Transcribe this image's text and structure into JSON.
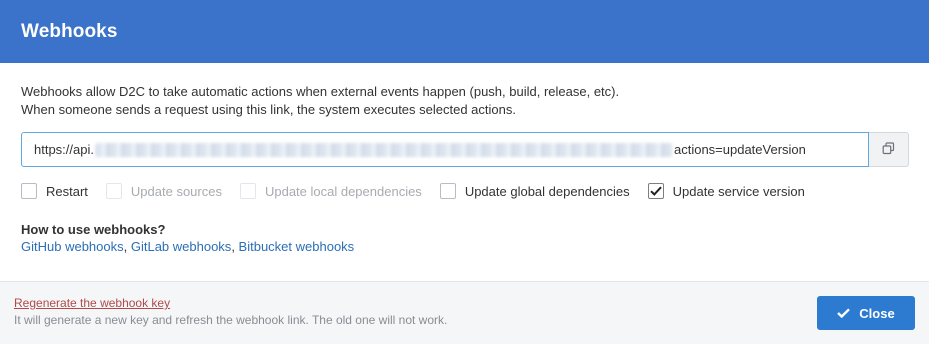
{
  "header": {
    "title": "Webhooks"
  },
  "description": {
    "line1": "Webhooks allow D2C to take automatic actions when external events happen (push, build, release, etc).",
    "line2": "When someone sends a request using this link, the system executes selected actions."
  },
  "url": {
    "prefix": "https://api.",
    "suffix": "actions=updateVersion",
    "middle_hidden": true
  },
  "options": [
    {
      "label": "Restart",
      "checked": false,
      "disabled": false
    },
    {
      "label": "Update sources",
      "checked": false,
      "disabled": true
    },
    {
      "label": "Update local dependencies",
      "checked": false,
      "disabled": true
    },
    {
      "label": "Update global dependencies",
      "checked": false,
      "disabled": false
    },
    {
      "label": "Update service version",
      "checked": true,
      "disabled": false
    }
  ],
  "howto": {
    "title": "How to use webhooks?",
    "links": [
      "GitHub webhooks",
      "GitLab webhooks",
      "Bitbucket webhooks"
    ],
    "separator": ", "
  },
  "footer": {
    "regenerate_label": "Regenerate the webhook key",
    "regenerate_note": "It will generate a new key and refresh the webhook link. The old one will not work.",
    "close_label": "Close"
  },
  "icons": {
    "copy": "copy-icon",
    "close_check": "check-icon"
  },
  "colors": {
    "header": "#3a73c9",
    "primary_button": "#2c7bd0",
    "link": "#2b6fb6",
    "regenerate": "#b24a4a"
  }
}
